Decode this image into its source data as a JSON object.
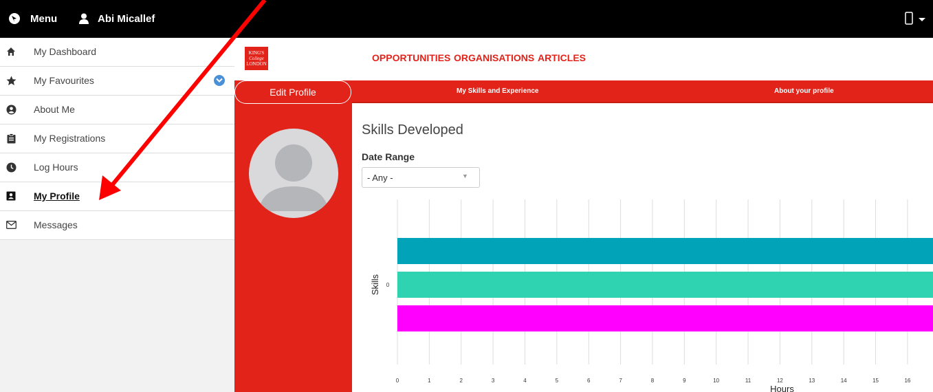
{
  "topbar": {
    "menu_label": "Menu",
    "user_name": "Abi Micallef"
  },
  "sidebar": {
    "items": [
      {
        "label": "My Dashboard",
        "icon": "home-icon"
      },
      {
        "label": "My Favourites",
        "icon": "star-icon"
      },
      {
        "label": "About Me",
        "icon": "user-circle-icon"
      },
      {
        "label": "My Registrations",
        "icon": "clipboard-icon"
      },
      {
        "label": "Log Hours",
        "icon": "clock-icon"
      },
      {
        "label": "My Profile",
        "icon": "id-card-icon"
      },
      {
        "label": "Messages",
        "icon": "envelope-icon"
      }
    ],
    "active_index": 5
  },
  "header": {
    "logo_text": [
      "KING'S",
      "College",
      "LONDON"
    ],
    "nav": [
      "OPPORTUNITIES",
      "ORGANISATIONS",
      "ARTICLES"
    ]
  },
  "profile": {
    "edit_label": "Edit Profile"
  },
  "tabs": [
    "My Skills and Experience",
    "About your profile"
  ],
  "skills": {
    "title": "Skills Developed",
    "date_range_label": "Date Range",
    "date_range_value": "- Any -"
  },
  "colors": {
    "brand_red": "#e2231a",
    "series_teal": "#00a3b8",
    "series_mint": "#2fd3b1",
    "series_magenta": "#ff00ff",
    "annotation_arrow": "#ff0000"
  },
  "chart_data": {
    "type": "bar",
    "orientation": "horizontal",
    "categories": [
      "0"
    ],
    "series": [
      {
        "values": [
          16.8
        ],
        "color": "#00a3b8"
      },
      {
        "values": [
          16.8
        ],
        "color": "#2fd3b1"
      },
      {
        "values": [
          16.8
        ],
        "color": "#ff00ff"
      }
    ],
    "xlabel": "Hours",
    "ylabel": "Skills",
    "x_ticks": [
      "0",
      "1",
      "2",
      "3",
      "4",
      "5",
      "6",
      "7",
      "8",
      "9",
      "10",
      "11",
      "12",
      "13",
      "14",
      "15",
      "16"
    ],
    "xlim": [
      0,
      16.8
    ],
    "grid": true
  }
}
